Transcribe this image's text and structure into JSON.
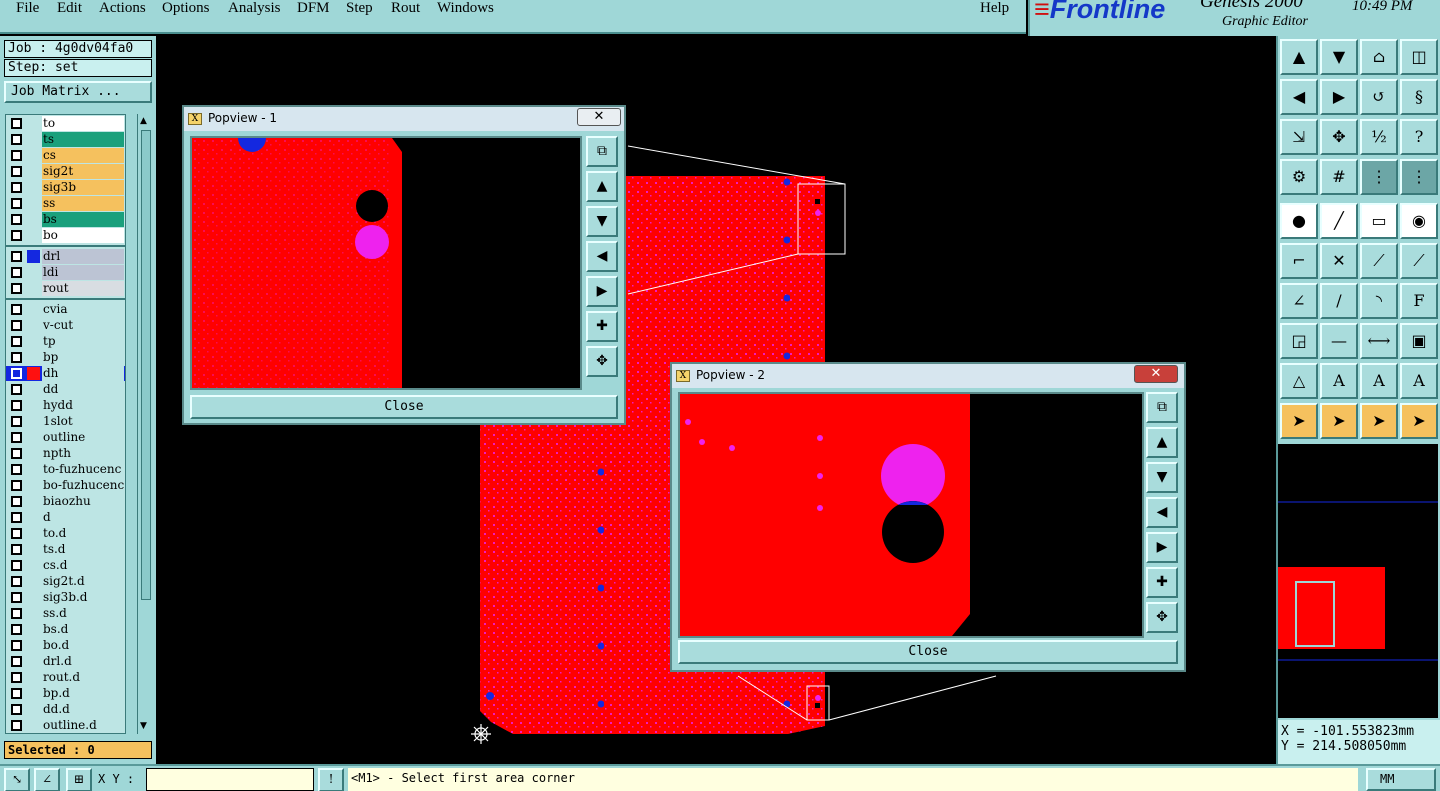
{
  "menu": {
    "items": [
      "File",
      "Edit",
      "Actions",
      "Options",
      "Analysis",
      "DFM",
      "Step",
      "Rout",
      "Windows"
    ],
    "help": "Help"
  },
  "brand": {
    "logo": "Frontline",
    "product": "Genesis 2000",
    "subtitle": "Graphic Editor",
    "time": "10:49 PM"
  },
  "job": {
    "job_label": "Job : 4g0dv04fa0",
    "step_label": "Step: set",
    "matrix_button": "Job Matrix ..."
  },
  "layers": [
    {
      "name": "to",
      "color": "#ffffff"
    },
    {
      "name": "ts",
      "color": "#1aa07c"
    },
    {
      "name": "cs",
      "color": "#f5c15e"
    },
    {
      "name": "sig2t",
      "color": "#f5c15e"
    },
    {
      "name": "sig3b",
      "color": "#f5c15e"
    },
    {
      "name": "ss",
      "color": "#f5c15e"
    },
    {
      "name": "bs",
      "color": "#1aa07c"
    },
    {
      "name": "bo",
      "color": "#ffffff"
    },
    {
      "name": "drl",
      "color": "#bcc4d4",
      "swatch": "#1428e0"
    },
    {
      "name": "ldi",
      "color": "#bcc4d4"
    },
    {
      "name": "rout",
      "color": "#d8dde2"
    },
    {
      "name": "cvia",
      "color": "#bde5e4"
    },
    {
      "name": "v-cut",
      "color": "#bde5e4"
    },
    {
      "name": "tp",
      "color": "#bde5e4"
    },
    {
      "name": "bp",
      "color": "#bde5e4"
    },
    {
      "name": "dh",
      "color": "#bde5e4",
      "swatch": "#ff1010",
      "active": true
    },
    {
      "name": "dd",
      "color": "#bde5e4"
    },
    {
      "name": "hydd",
      "color": "#bde5e4"
    },
    {
      "name": "1slot",
      "color": "#bde5e4"
    },
    {
      "name": "outline",
      "color": "#bde5e4"
    },
    {
      "name": "npth",
      "color": "#bde5e4"
    },
    {
      "name": "to-fuzhucenc",
      "color": "#bde5e4"
    },
    {
      "name": "bo-fuzhucenc",
      "color": "#bde5e4"
    },
    {
      "name": "biaozhu",
      "color": "#bde5e4"
    },
    {
      "name": "d",
      "color": "#bde5e4"
    },
    {
      "name": "to.d",
      "color": "#bde5e4"
    },
    {
      "name": "ts.d",
      "color": "#bde5e4"
    },
    {
      "name": "cs.d",
      "color": "#bde5e4"
    },
    {
      "name": "sig2t.d",
      "color": "#bde5e4"
    },
    {
      "name": "sig3b.d",
      "color": "#bde5e4"
    },
    {
      "name": "ss.d",
      "color": "#bde5e4"
    },
    {
      "name": "bs.d",
      "color": "#bde5e4"
    },
    {
      "name": "bo.d",
      "color": "#bde5e4"
    },
    {
      "name": "drl.d",
      "color": "#bde5e4"
    },
    {
      "name": "rout.d",
      "color": "#bde5e4"
    },
    {
      "name": "bp.d",
      "color": "#bde5e4"
    },
    {
      "name": "dd.d",
      "color": "#bde5e4"
    },
    {
      "name": "outline.d",
      "color": "#bde5e4"
    }
  ],
  "selected": "Selected : 0",
  "popview1": {
    "title": "Popview - 1",
    "close_label": "Close",
    "x": "✕"
  },
  "popview2": {
    "title": "Popview - 2",
    "close_label": "Close",
    "x": "✕"
  },
  "coords": {
    "x": "X = -101.553823mm",
    "y": "Y = 214.508050mm"
  },
  "status": {
    "xy_label": "X Y :",
    "xy_value": "",
    "prompt": "<M1> - Select first area corner",
    "units": "MM"
  },
  "colors": {
    "panel": "#9fd7d7",
    "board": "#ff0000",
    "pad": "#ee22ee",
    "drill": "#1428e0"
  }
}
